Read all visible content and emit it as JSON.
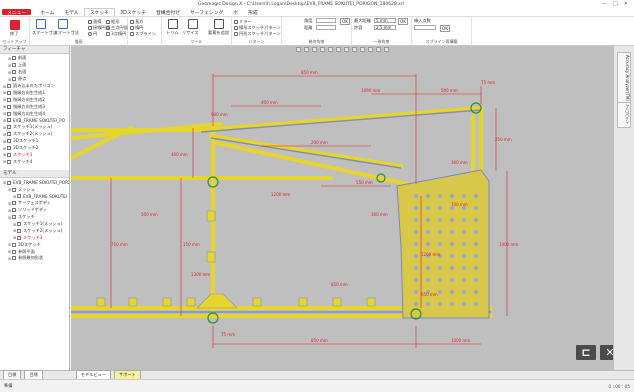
{
  "window": {
    "title": "Geomagic Design X - C:\\Users\\h.Logan\\Desktop\\EVB_FRAME SOKUTEI_PORIGON_180628.xrl",
    "controls": [
      "—",
      "□",
      "✕"
    ]
  },
  "menu": [
    {
      "label": "メニュー",
      "style": "red"
    },
    {
      "label": "ホーム"
    },
    {
      "label": "モデル"
    },
    {
      "label": "スケッチ",
      "style": "active"
    },
    {
      "label": "3Dスケッチ"
    },
    {
      "label": "音構合付ぜ"
    },
    {
      "label": "サーフェシング"
    },
    {
      "label": "ボ"
    },
    {
      "label": "形成"
    }
  ],
  "ribbon": {
    "setup": {
      "label": "セットアップ",
      "big": "終了"
    },
    "draw": {
      "label": "描画",
      "items": [
        "スマート寸法",
        "スマート寸法",
        "直線",
        "接線円弧",
        "円",
        "矩形",
        "三点円弧",
        "3点楕円",
        "長方",
        "楕円",
        "スプライン"
      ]
    },
    "tool": {
      "label": "ツール",
      "items": [
        "トリム",
        "リサイズ",
        "要素を追加"
      ]
    },
    "pattern": {
      "label": "パターン",
      "items": [
        "ミラー",
        "線形スケッチパターン",
        "円形スケッチパターン"
      ]
    },
    "constraint": {
      "label": "幾何拘束",
      "items": [
        "角度",
        "距離",
        "最大距離",
        "5 mm",
        "許容",
        "2.5 mm",
        "OK"
      ]
    },
    "fit": {
      "label": "一致拘束",
      "items": [
        "挿入点数"
      ]
    },
    "spline": {
      "label": "スプライン再構築"
    }
  },
  "feature_panel": {
    "title": "フィーチャ",
    "rows": [
      {
        "label": "前面",
        "indent": 1
      },
      {
        "label": "上面",
        "indent": 1
      },
      {
        "label": "右面",
        "indent": 1
      },
      {
        "label": "原点",
        "indent": 1
      },
      {
        "label": "読み込まれたポリゴン",
        "indent": 0
      },
      {
        "label": "指縁方向生生成1",
        "indent": 0
      },
      {
        "label": "指縁方向生生成2",
        "indent": 0
      },
      {
        "label": "指縁方向生生成3",
        "indent": 0
      },
      {
        "label": "指縁方向生生成4",
        "indent": 0
      },
      {
        "label": "EVB_FRAME SOKUTEI_PO",
        "indent": 0
      },
      {
        "label": "スケッチ1(メッシュ)",
        "indent": 0
      },
      {
        "label": "スケッチ2(メッシュ)",
        "indent": 0
      },
      {
        "label": "3Dスケッチ1",
        "indent": 0
      },
      {
        "label": "3Dスケッチ2",
        "indent": 0
      },
      {
        "label": "スケッチ3",
        "indent": 0,
        "red": true
      },
      {
        "label": "スケッチ4",
        "indent": 0
      }
    ]
  },
  "model_panel": {
    "title": "モデル",
    "rows": [
      {
        "label": "EVB_FRAME SOKUTEI_POR2",
        "indent": 0
      },
      {
        "label": "メッシュ",
        "indent": 1
      },
      {
        "label": "EVB_FRAME SOKUTEI",
        "indent": 2
      },
      {
        "label": "サーフェスボディ",
        "indent": 1
      },
      {
        "label": "ソリッドボディ",
        "indent": 1
      },
      {
        "label": "スケッチ",
        "indent": 1
      },
      {
        "label": "スケッチ1(メッシュ)",
        "indent": 2
      },
      {
        "label": "スケッチ2(メッシュ)",
        "indent": 2
      },
      {
        "label": "スケッチ3",
        "indent": 2,
        "red": true
      },
      {
        "label": "3Dスケッチ",
        "indent": 1
      },
      {
        "label": "参照平面",
        "indent": 1
      },
      {
        "label": "参照幾何形状",
        "indent": 1
      }
    ]
  },
  "right_tabs": [
    "Accuracy Analyzer(TM)",
    "プロパティ"
  ],
  "bottom_tabs": [
    {
      "label": "モデルビュー",
      "active": false
    },
    {
      "label": "サポート",
      "active": true
    }
  ],
  "bottom_left": [
    "目標",
    "目標"
  ],
  "status": {
    "left": "準備",
    "right": "0 : 00 : 05"
  },
  "dimensions": [
    "850 mm",
    "1090 mm",
    "500 mm",
    "75 mm",
    "400 mm",
    "900 mm",
    "200 mm",
    "400 mm",
    "550 mm",
    "150 mm",
    "700 mm",
    "1300 mm",
    "250 mm",
    "1400 mm",
    "1200 mm",
    "300 mm",
    "750 mm",
    "850 mm",
    "1000 mm",
    "300 mm",
    "650 mm",
    "1200 mm",
    "850 mm",
    "500 mm",
    "75 mm"
  ],
  "nav_buttons": {
    "back": "⊏",
    "close": "✕"
  },
  "colors": {
    "accent": "#d9232e",
    "frame": "#e6d62b",
    "plate": "#d8c84a",
    "viewport": "#bfbfbf",
    "dim": "#d9232e"
  }
}
